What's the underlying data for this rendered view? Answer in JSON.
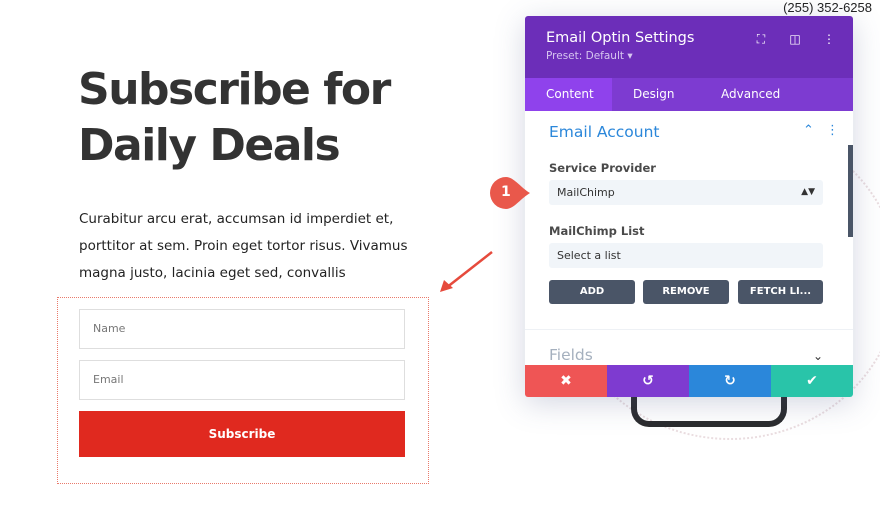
{
  "header": {
    "phone": "(255) 352-6258"
  },
  "hero": {
    "headline_line1": "Subscribe for",
    "headline_line2": "Daily Deals",
    "intro_line1": "Curabitur arcu erat, accumsan id imperdiet et,",
    "intro_line2": "porttitor at sem. Proin eget tortor risus. Vivamus",
    "intro_line3": "magna justo, lacinia eget sed, convallis"
  },
  "form": {
    "name_placeholder": "Name",
    "email_placeholder": "Email",
    "subscribe_label": "Subscribe",
    "button_color": "#e0291f"
  },
  "panel": {
    "title": "Email Optin Settings",
    "preset": "Preset: Default ▾",
    "icons": [
      "fullscreen-icon",
      "split-view-icon",
      "more-options-icon"
    ],
    "tabs": [
      {
        "label": "Content",
        "active": true
      },
      {
        "label": "Design",
        "active": false
      },
      {
        "label": "Advanced",
        "active": false
      }
    ],
    "section_title": "Email Account",
    "service_provider_label": "Service Provider",
    "service_provider_value": "MailChimp",
    "mailchimp_list_label": "MailChimp List",
    "mailchimp_list_value": "Select a list",
    "buttons": {
      "add": "ADD",
      "remove": "REMOVE",
      "fetch": "FETCH LI..."
    },
    "fields_section": "Fields",
    "actions": {
      "cancel": "✖",
      "undo": "↺",
      "redo": "↻",
      "save": "✔"
    },
    "colors": {
      "header": "#6c2eb9",
      "tabs": "#7d3bd1",
      "accent": "#2b87da",
      "cancel": "#ef5555",
      "undo": "#7e3bd0",
      "redo": "#2b87da",
      "save": "#29c4a9"
    }
  },
  "annotation": {
    "step_badge": "1"
  }
}
